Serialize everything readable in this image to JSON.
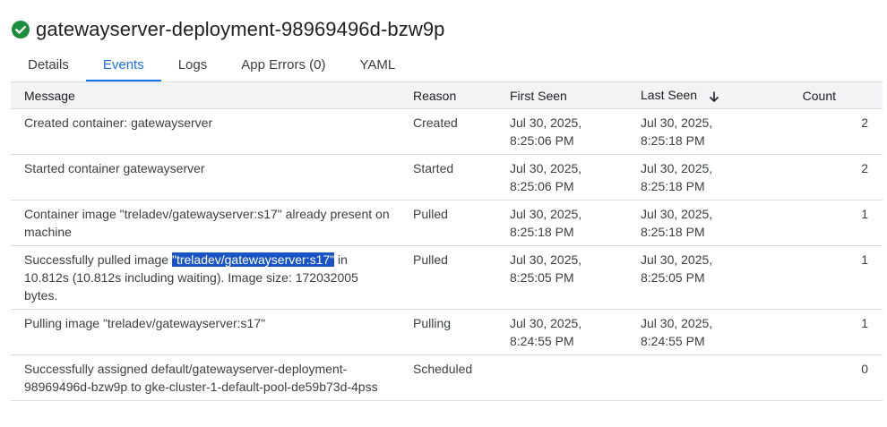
{
  "header": {
    "title": "gatewayserver-deployment-98969496d-bzw9p",
    "status_icon": "check-circle-icon",
    "status_color": "#1e8e3e"
  },
  "tabs": [
    {
      "label": "Details"
    },
    {
      "label": "Events"
    },
    {
      "label": "Logs"
    },
    {
      "label": "App Errors (0)"
    },
    {
      "label": "YAML"
    }
  ],
  "active_tab": "Events",
  "table": {
    "columns": {
      "message": "Message",
      "reason": "Reason",
      "first_seen": "First Seen",
      "last_seen": "Last Seen",
      "count": "Count"
    },
    "sort_column": "Last Seen",
    "sort_icon": "arrow-down-icon",
    "rows": [
      {
        "message": "Created container: gatewayserver",
        "reason": "Created",
        "first_seen": [
          "Jul 30, 2025,",
          "8:25:06 PM"
        ],
        "last_seen": [
          "Jul 30, 2025,",
          "8:25:18 PM"
        ],
        "count": "2"
      },
      {
        "message": "Started container gatewayserver",
        "reason": "Started",
        "first_seen": [
          "Jul 30, 2025,",
          "8:25:06 PM"
        ],
        "last_seen": [
          "Jul 30, 2025,",
          "8:25:18 PM"
        ],
        "count": "2"
      },
      {
        "message": "Container image \"treladev/gatewayserver:s17\" already present on machine",
        "reason": "Pulled",
        "first_seen": [
          "Jul 30, 2025,",
          "8:25:18 PM"
        ],
        "last_seen": [
          "Jul 30, 2025,",
          "8:25:18 PM"
        ],
        "count": "1"
      },
      {
        "message_parts": {
          "before": "Successfully pulled image ",
          "highlighted": "\"treladev/gatewayserver:s17\"",
          "after": " in 10.812s (10.812s including waiting). Image size: 172032005 bytes."
        },
        "reason": "Pulled",
        "first_seen": [
          "Jul 30, 2025,",
          "8:25:05 PM"
        ],
        "last_seen": [
          "Jul 30, 2025,",
          "8:25:05 PM"
        ],
        "count": "1"
      },
      {
        "message": "Pulling image \"treladev/gatewayserver:s17\"",
        "reason": "Pulling",
        "first_seen": [
          "Jul 30, 2025,",
          "8:24:55 PM"
        ],
        "last_seen": [
          "Jul 30, 2025,",
          "8:24:55 PM"
        ],
        "count": "1"
      },
      {
        "message": "Successfully assigned default/gatewayserver-deployment-98969496d-bzw9p to gke-cluster-1-default-pool-de59b73d-4pss",
        "reason": "Scheduled",
        "first_seen": [
          "",
          ""
        ],
        "last_seen": [
          "",
          ""
        ],
        "count": "0"
      }
    ]
  }
}
